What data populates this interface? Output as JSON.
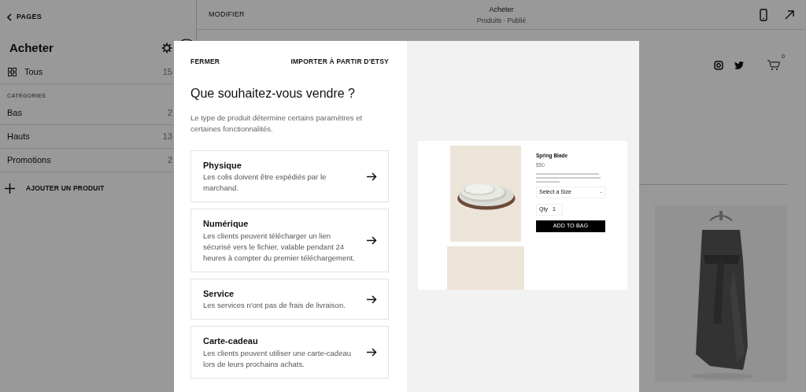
{
  "sidebar": {
    "back_link": "PAGES",
    "title": "Acheter",
    "all_item": {
      "label": "Tous",
      "count": "15"
    },
    "section_label": "CATÉGORIES",
    "categories": [
      {
        "label": "Bas",
        "count": "2"
      },
      {
        "label": "Hauts",
        "count": "13"
      },
      {
        "label": "Promotions",
        "count": "2"
      }
    ],
    "add_button": "AJOUTER UN PRODUIT"
  },
  "top_bar": {
    "edit_button": "MODIFIER",
    "page_title": "Acheter",
    "page_subtitle": "Produits · Publié"
  },
  "site_header": {
    "cart_count": "0"
  },
  "modal": {
    "close_button": "FERMER",
    "import_button": "IMPORTER À PARTIR D'ETSY",
    "heading": "Que souhaitez-vous vendre ?",
    "description": "Le type de produit détermine certains paramètres et certaines fonctionnalités.",
    "options": [
      {
        "title": "Physique",
        "description": "Les colis doivent être expédiés par le marchand."
      },
      {
        "title": "Numérique",
        "description": "Les clients peuvent télécharger un lien sécurisé vers le fichier, valable pendant 24 heures à compter du premier téléchargement."
      },
      {
        "title": "Service",
        "description": "Les services n'ont pas de frais de livraison."
      },
      {
        "title": "Carte-cadeau",
        "description": "Les clients peuvent utiliser une carte-cadeau lors de leurs prochains achats."
      }
    ],
    "preview": {
      "product_name": "Spring Blade",
      "price": "$50",
      "size_select": "Select a Size",
      "qty_label": "Qty",
      "qty_value": "1",
      "add_button": "ADD TO BAG"
    }
  }
}
